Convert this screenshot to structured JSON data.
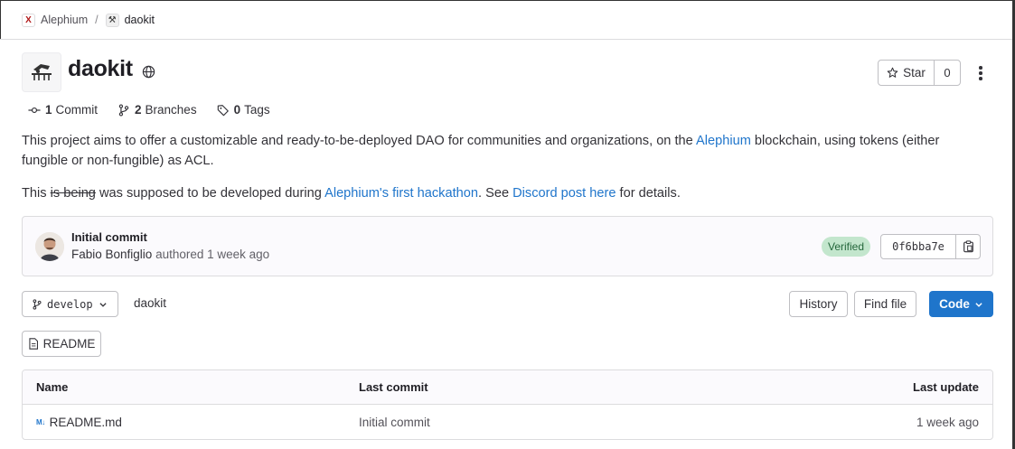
{
  "breadcrumb": {
    "group": "Alephium",
    "separator": "/",
    "project": "daokit",
    "group_avatar": "X",
    "project_avatar": "⚒"
  },
  "project": {
    "title": "daokit",
    "visibility_icon": "globe-icon",
    "star_label": "Star",
    "star_count": "0"
  },
  "stats": [
    {
      "icon": "commit-icon",
      "count": "1",
      "label": "Commit"
    },
    {
      "icon": "branch-icon",
      "count": "2",
      "label": "Branches"
    },
    {
      "icon": "tag-icon",
      "count": "0",
      "label": "Tags"
    }
  ],
  "description": {
    "line1_a": "This project aims to offer a customizable and ready-to-be-deployed DAO for communities and organizations, on the ",
    "line1_link": "Alephium",
    "line1_b": " blockchain, using tokens (either fungible or non-fungible) as ACL.",
    "line2_a": "This ",
    "line2_strike": "is being",
    "line2_b": " was supposed to be developed during ",
    "line2_link1": "Alephium's first hackathon",
    "line2_c": ". See ",
    "line2_link2": "Discord post here",
    "line2_d": " for details."
  },
  "last_commit": {
    "title": "Initial commit",
    "author": "Fabio Bonfiglio",
    "meta_suffix": " authored 1 week ago",
    "verified_label": "Verified",
    "sha": "0f6bba7e"
  },
  "toolbar": {
    "branch": "develop",
    "path": "daokit",
    "history_label": "History",
    "find_file_label": "Find file",
    "code_label": "Code",
    "readme_label": "README"
  },
  "table": {
    "headers": {
      "name": "Name",
      "last_commit": "Last commit",
      "last_update": "Last update"
    },
    "rows": [
      {
        "icon": "M↓",
        "name": "README.md",
        "last_commit": "Initial commit",
        "last_update": "1 week ago"
      }
    ]
  },
  "colors": {
    "link": "#1f75cb",
    "primary_button": "#1f75cb",
    "verified_bg": "#c3e6cd",
    "verified_text": "#24663b"
  }
}
